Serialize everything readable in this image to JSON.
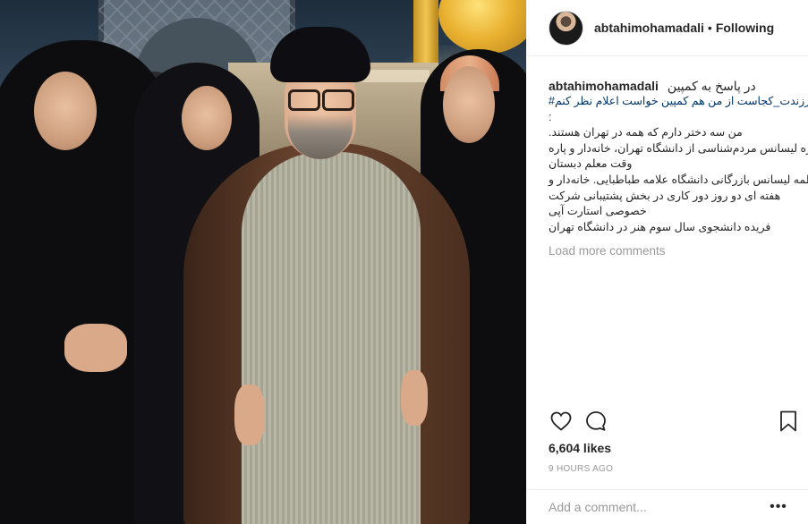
{
  "header": {
    "username": "abtahimohamadali",
    "separator": "•",
    "follow_state": "Following"
  },
  "caption": {
    "username": "abtahimohamadali",
    "first_line": "در پاسخ به کمپین",
    "lines": [
      "#فرزندت_کجاست از من هم کمپین خواست اعلام نظر کنم",
      ":",
      ".من سه دختر دارم که همه در تهران هستند",
      "فائزه لیسانس مردم‌شناسی از دانشگاه تهران، خانه‌دار و پاره",
      "وقت معلم دبستان",
      "فاطمه لیسانس بازرگانی دانشگاه علامه طباطبایی. خانه‌دار و",
      "هفته ای دو روز دور کاری در بخش پشتیبانی شرکت",
      "خصوصی استارت آپی",
      "فریده دانشجوی سال سوم هنر در دانشگاه تهران"
    ],
    "load_more": "Load more comments"
  },
  "actions": {
    "like_icon": "heart-icon",
    "comment_icon": "comment-icon",
    "save_icon": "bookmark-icon"
  },
  "likes": "6,604 likes",
  "timestamp": "9 HOURS AGO",
  "comment_box": {
    "placeholder": "Add a comment...",
    "more_label": "•••"
  },
  "colors": {
    "text": "#262626",
    "muted": "#999999",
    "hashtag": "#003569",
    "border": "#efefef"
  }
}
